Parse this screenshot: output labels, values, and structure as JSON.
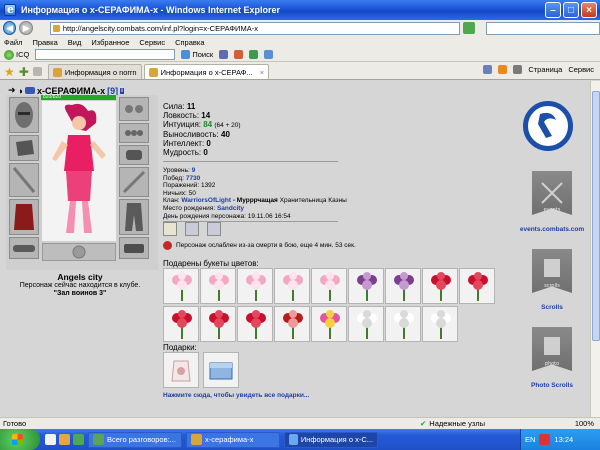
{
  "window": {
    "title": "Информация о х-СЕРАФИМА-х - Windows Internet Explorer",
    "url": "http://angelscity.combats.com/inf.pl?login=х-СЕРАФИМА-х"
  },
  "menu": [
    "Файл",
    "Правка",
    "Вид",
    "Избранное",
    "Сервис",
    "Справка"
  ],
  "links": {
    "icq": "ICQ",
    "search": "Поиск"
  },
  "tabs": [
    {
      "label": "Информация о norrn"
    },
    {
      "label": "Информация о х-СЕРАФ..."
    }
  ],
  "toolbar_right": {
    "page": "Страница",
    "service": "Сервис"
  },
  "character": {
    "name": "х-СЕРАФИМА-х",
    "level": "[9]",
    "hp": "820/820",
    "city": "Angels city",
    "location_line": "Персонаж сейчас находится в клубе.",
    "room": "\"Зал воинов 3\""
  },
  "stats": [
    {
      "label": "Сила:",
      "value": "11",
      "extra": ""
    },
    {
      "label": "Ловкость:",
      "value": "14",
      "extra": ""
    },
    {
      "label": "Интуиция:",
      "value": "84",
      "extra": "(64 + 20)"
    },
    {
      "label": "Выносливость:",
      "value": "40",
      "extra": ""
    },
    {
      "label": "Интеллект:",
      "value": "0",
      "extra": ""
    },
    {
      "label": "Мудрость:",
      "value": "0",
      "extra": ""
    }
  ],
  "info": {
    "level_label": "Уровень:",
    "level": "9",
    "wins_label": "Побед:",
    "wins": "7730",
    "losses_label": "Поражений:",
    "losses": "1392",
    "draws_label": "Ничьих:",
    "draws": "50",
    "clan_label": "Клан:",
    "clan": "WarriorsOfLight",
    "clan_rank": "- Мурррчащая",
    "clan_title": "Хранительница Казны",
    "birthplace_label": "Место рождения:",
    "birthplace": "Sandcity",
    "birthday_label": "День рождения персонажа:",
    "birthday": "19.11.06 16:54"
  },
  "penalty": "Персонаж ослаблен из-за смерти в бою, еще 4 мин. 53 сек.",
  "flowers_title": "Подарены букеты цветов:",
  "flowers": [
    "pink",
    "pink",
    "pink",
    "pink",
    "pink",
    "purple-lily",
    "purple-lily",
    "red-rose",
    "red-rose",
    "red-rose",
    "red-rose",
    "red-rose",
    "red-carnation",
    "mixed",
    "white-lily",
    "white-lily",
    "white-lily"
  ],
  "gifts_title": "Подарки:",
  "gifts_link": "Нажмите сюда, чтобы увидеть все подарки...",
  "right_links": {
    "events": "events.combats.com",
    "scrolls": "Scrolls",
    "photo_scrolls": "Photo Scrolls",
    "banner1_text": "events",
    "banner2_text": "scrolls",
    "banner3_text": "photo"
  },
  "status": {
    "left": "Готово",
    "zone": "Надежные узлы",
    "zoom": "100%"
  },
  "taskbar": {
    "tasks": [
      "Всего разговоров:...",
      "х-серафима-х",
      "Информация о х-С..."
    ],
    "lang": "EN",
    "clock": "13:24"
  },
  "colors": {
    "accent_blue": "#1b4fa9",
    "hp_green": "#22a822",
    "link_blue": "#1d3fa3"
  }
}
